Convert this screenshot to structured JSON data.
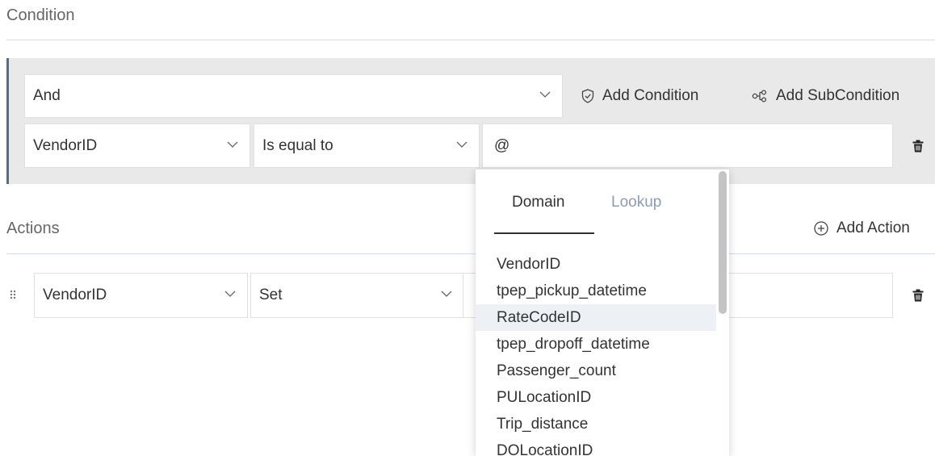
{
  "condition": {
    "title": "Condition",
    "logic_select": {
      "value": "And"
    },
    "add_condition_label": "Add Condition",
    "add_subcondition_label": "Add SubCondition",
    "row": {
      "field": "VendorID",
      "operator": "Is equal to",
      "value": "@"
    }
  },
  "actions": {
    "title": "Actions",
    "add_action_label": "Add Action",
    "row": {
      "field": "VendorID",
      "operation": "Set"
    }
  },
  "autocomplete": {
    "tabs": [
      {
        "label": "Domain",
        "active": true
      },
      {
        "label": "Lookup",
        "active": false
      }
    ],
    "items": [
      "VendorID",
      "tpep_pickup_datetime",
      "RateCodeID",
      "tpep_dropoff_datetime",
      "Passenger_count",
      "PULocationID",
      "Trip_distance",
      "DOLocationID"
    ],
    "highlighted_index": 2
  },
  "colors": {
    "panel_bg": "#e9e9e9",
    "panel_accent": "#5f6b7a",
    "divider": "#d3dde8",
    "inactive_tab": "#8f9bb0",
    "highlight": "#edf0f4"
  }
}
